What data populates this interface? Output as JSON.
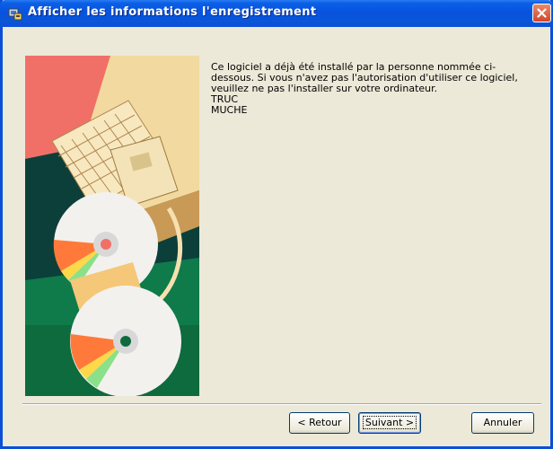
{
  "window": {
    "title": "Afficher les informations l'enregistrement",
    "colors": {
      "titlebar": "#0a56d6",
      "face": "#ece9d8",
      "close": "#d2452b"
    }
  },
  "content": {
    "message": "Ce logiciel a déjà été installé par la personne nommée ci-dessous. Si vous n'avez pas l'autorisation d'utiliser ce logiciel, veuillez ne pas l'installer sur votre ordinateur.",
    "user_line1": "TRUC",
    "user_line2": "MUCHE"
  },
  "buttons": {
    "back": "< Retour",
    "next": "Suivant >",
    "cancel": "Annuler"
  },
  "icons": {
    "title": "setup-icon",
    "close": "close-icon",
    "graphic": "computer-disk-illustration"
  }
}
